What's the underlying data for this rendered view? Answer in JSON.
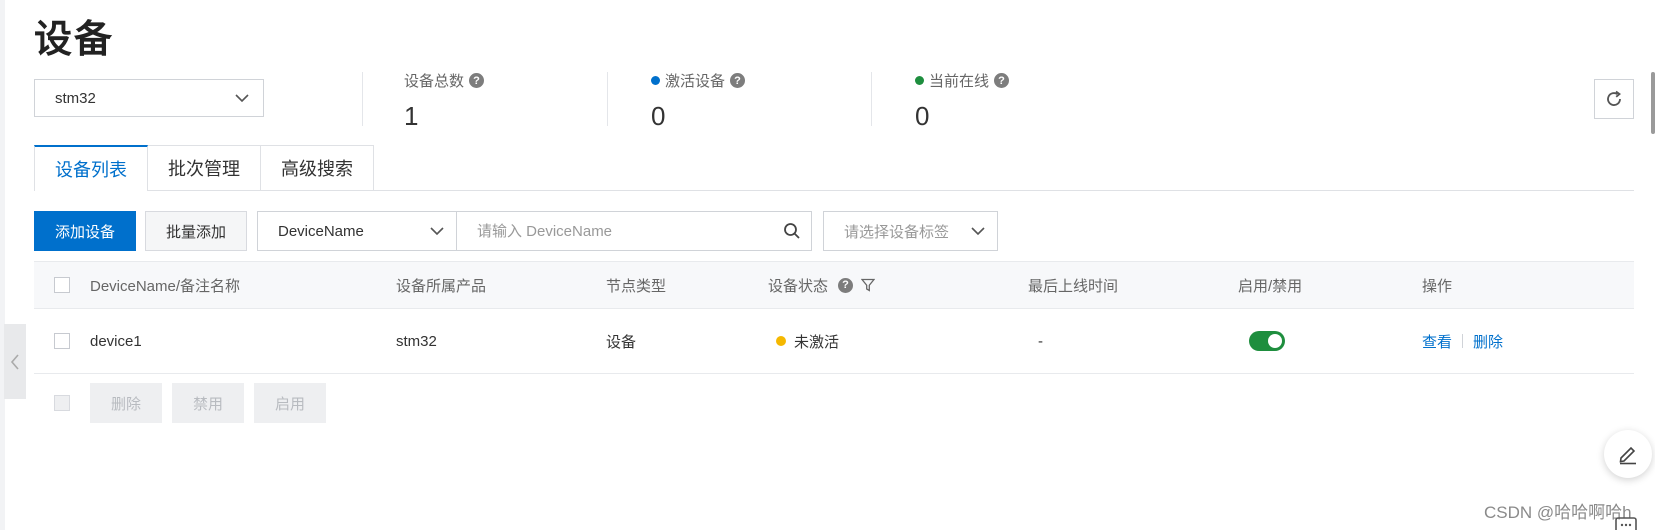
{
  "page": {
    "title": "设备"
  },
  "product_select": {
    "value": "stm32"
  },
  "stats": [
    {
      "label": "设备总数",
      "value": "1",
      "dot_color": ""
    },
    {
      "label": "激活设备",
      "value": "0",
      "dot_color": "#0070cc"
    },
    {
      "label": "当前在线",
      "value": "0",
      "dot_color": "#1e8e3e"
    }
  ],
  "help_glyph": "?",
  "tabs": [
    {
      "label": "设备列表",
      "active": true
    },
    {
      "label": "批次管理",
      "active": false
    },
    {
      "label": "高级搜索",
      "active": false
    }
  ],
  "toolbar": {
    "add_device": "添加设备",
    "batch_add": "批量添加",
    "field_select": "DeviceName",
    "search_placeholder": "请输入 DeviceName",
    "tag_placeholder": "请选择设备标签"
  },
  "table": {
    "columns": {
      "name": "DeviceName/备注名称",
      "product": "设备所属产品",
      "node_type": "节点类型",
      "status": "设备状态",
      "last_online": "最后上线时间",
      "enable": "启用/禁用",
      "actions": "操作"
    },
    "rows": [
      {
        "name": "device1",
        "product": "stm32",
        "node_type": "设备",
        "status": "未激活",
        "status_color": "#f5b800",
        "last_online": "-",
        "enabled": true,
        "view": "查看",
        "delete": "删除"
      }
    ]
  },
  "bulk_actions": {
    "delete": "删除",
    "disable": "禁用",
    "enable": "启用"
  },
  "watermark": "CSDN @哈哈啊哈h",
  "icons": [
    "chevron-down-icon",
    "help-icon",
    "refresh-icon",
    "search-icon",
    "filter-icon",
    "edit-icon",
    "chevron-left-icon",
    "chat-icon"
  ],
  "colors": {
    "primary": "#0070cc",
    "success": "#1e8e3e",
    "warning": "#f5b800"
  }
}
